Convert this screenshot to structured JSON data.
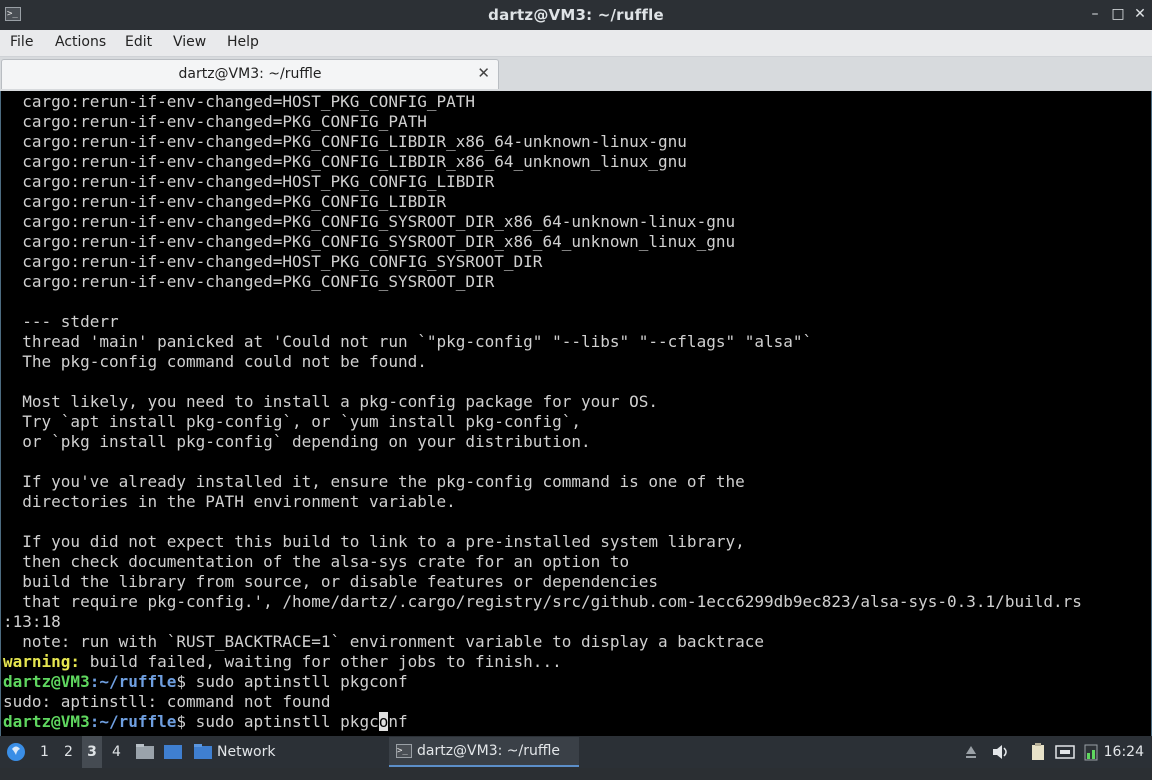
{
  "window": {
    "title": "dartz@VM3: ~/ruffle",
    "app_icon_glyph": ">_",
    "buttons": {
      "minimize": "–",
      "maximize": "□",
      "close": "✕"
    }
  },
  "menu": {
    "file": "File",
    "actions": "Actions",
    "edit": "Edit",
    "view": "View",
    "help": "Help"
  },
  "tab": {
    "label": "dartz@VM3: ~/ruffle",
    "close": "✕"
  },
  "terminal": {
    "lines": [
      "  cargo:rerun-if-env-changed=HOST_PKG_CONFIG_PATH",
      "  cargo:rerun-if-env-changed=PKG_CONFIG_PATH",
      "  cargo:rerun-if-env-changed=PKG_CONFIG_LIBDIR_x86_64-unknown-linux-gnu",
      "  cargo:rerun-if-env-changed=PKG_CONFIG_LIBDIR_x86_64_unknown_linux_gnu",
      "  cargo:rerun-if-env-changed=HOST_PKG_CONFIG_LIBDIR",
      "  cargo:rerun-if-env-changed=PKG_CONFIG_LIBDIR",
      "  cargo:rerun-if-env-changed=PKG_CONFIG_SYSROOT_DIR_x86_64-unknown-linux-gnu",
      "  cargo:rerun-if-env-changed=PKG_CONFIG_SYSROOT_DIR_x86_64_unknown_linux_gnu",
      "  cargo:rerun-if-env-changed=HOST_PKG_CONFIG_SYSROOT_DIR",
      "  cargo:rerun-if-env-changed=PKG_CONFIG_SYSROOT_DIR",
      "",
      "  --- stderr",
      "  thread 'main' panicked at 'Could not run `\"pkg-config\" \"--libs\" \"--cflags\" \"alsa\"`",
      "  The pkg-config command could not be found.",
      "",
      "  Most likely, you need to install a pkg-config package for your OS.",
      "  Try `apt install pkg-config`, or `yum install pkg-config`,",
      "  or `pkg install pkg-config` depending on your distribution.",
      "",
      "  If you've already installed it, ensure the pkg-config command is one of the",
      "  directories in the PATH environment variable.",
      "",
      "  If you did not expect this build to link to a pre-installed system library,",
      "  then check documentation of the alsa-sys crate for an option to",
      "  build the library from source, or disable features or dependencies",
      "  that require pkg-config.', /home/dartz/.cargo/registry/src/github.com-1ecc6299db9ec823/alsa-sys-0.3.1/build.rs",
      ":13:18",
      "  note: run with `RUST_BACKTRACE=1` environment variable to display a backtrace"
    ],
    "warning_label": "warning:",
    "warning_text": " build failed, waiting for other jobs to finish...",
    "prompt_user": "dartz@VM3",
    "prompt_sep": ":",
    "prompt_path": "~/ruffle",
    "prompt_dollar": "$",
    "cmd1": " sudo aptinstll pkgconf",
    "error_line": "sudo: aptinstll: command not found",
    "cmd2_before": " sudo aptinstll pkgc",
    "cmd2_cursor": "o",
    "cmd2_after": "nf"
  },
  "taskbar": {
    "workspaces": [
      "1",
      "2",
      "3",
      "4"
    ],
    "active_workspace": "3",
    "folder_label": "Network",
    "task_label": "dartz@VM3: ~/ruffle",
    "clock": "16:24",
    "colors": {
      "accent": "#5c8fc9",
      "folder": "#3f7fd0"
    }
  }
}
